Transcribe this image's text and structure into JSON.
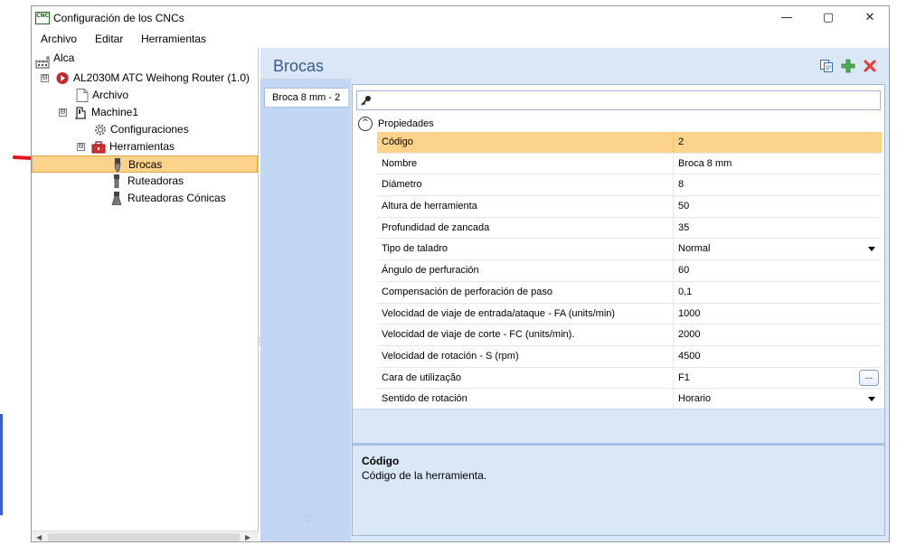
{
  "window": {
    "icon_text": "CNC",
    "title": "Configuración de los CNCs",
    "min_glyph": "—",
    "max_glyph": "▢",
    "close_glyph": "✕"
  },
  "menu": [
    "Archivo",
    "Editar",
    "Herramientas"
  ],
  "tree": [
    {
      "label": "Alca",
      "icon": "factory-icon"
    },
    {
      "label": "AL2030M ATC Weihong Router (1.0)",
      "icon": "machine-brand-icon",
      "expander": "⊟"
    },
    {
      "label": "Archivo",
      "icon": "file-icon"
    },
    {
      "label": "Machine1",
      "icon": "machine-icon",
      "expander": "⊟"
    },
    {
      "label": "Configuraciones",
      "icon": "gear-icon"
    },
    {
      "label": "Herramientas",
      "icon": "toolbox-icon",
      "expander": "⊟"
    },
    {
      "label": "Brocas",
      "icon": "drill-bit-icon",
      "selected": true
    },
    {
      "label": "Ruteadoras",
      "icon": "router-bit-icon"
    },
    {
      "label": "Ruteadoras Cónicas",
      "icon": "conical-router-icon"
    }
  ],
  "panel": {
    "title": "Brocas",
    "tab_label": "Broca 8 mm - 2",
    "search_placeholder": "",
    "category_label": "Propiedades",
    "category_toggle": "^"
  },
  "properties": [
    {
      "name": "Código",
      "value": "2",
      "selected": true
    },
    {
      "name": "Nombre",
      "value": "Broca 8 mm"
    },
    {
      "name": "Diámetro",
      "value": "8"
    },
    {
      "name": "Altura de herramienta",
      "value": "50"
    },
    {
      "name": "Profundidad de zancada",
      "value": "35"
    },
    {
      "name": "Tipo de taladro",
      "value": "Normal",
      "editor": "dropdown"
    },
    {
      "name": "Ángulo de perfuración",
      "value": "60"
    },
    {
      "name": "Compensación de perforación de paso",
      "value": "0,1"
    },
    {
      "name": "Velocidad de viaje de entrada/ataque - FA (units/min)",
      "value": "1000"
    },
    {
      "name": "Velocidad de viaje de corte - FC (units/min).",
      "value": "2000"
    },
    {
      "name": "Velocidad de rotación - S (rpm)",
      "value": "4500"
    },
    {
      "name": "Cara de utilização",
      "value": "F1",
      "editor": "ellipsis"
    },
    {
      "name": "Sentido de rotación",
      "value": "Horario",
      "editor": "dropdown"
    }
  ],
  "ellipsis_label": "...",
  "help": {
    "title": "Código",
    "description": "Código de la herramienta."
  },
  "colors": {
    "selection": "#fbd38a",
    "panel_bg": "#dae7f7",
    "title_blue": "#3b5b8a",
    "arrow_red": "#e8141c"
  }
}
